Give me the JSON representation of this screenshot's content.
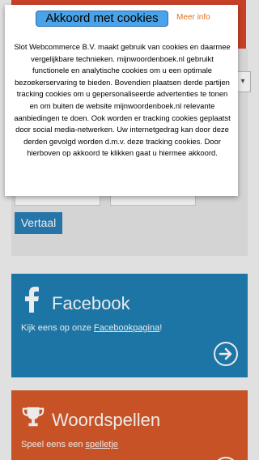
{
  "cookie_banner": {
    "accept_label": "Akkoord met cookies",
    "more_info_label": "Meer info",
    "body_text": "Slot Webcommerce B.V. maakt gebruik van cookies en daarmee vergelijkbare technieken. mijnwoordenboek.nl gebruikt functionele en analytische cookies om u een optimale bezoekerservaring te bieden. Bovendien plaatsen derde partijen tracking cookies om u gepersonaliseerde advertenties te tonen en om buiten de website mijnwoordenboek.nl relevante aanbiedingen te doen. Ook worden er tracking cookies geplaatst door social media-netwerken. Uw internetgedrag kan door deze derden gevolgd worden d.m.v. deze tracking cookies. Door hierboven op akkoord te klikken gaat u hiermee akkoord."
  },
  "translate_form": {
    "submit_label": "Vertaal"
  },
  "facebook_card": {
    "title": "Facebook",
    "text_prefix": "Kijk eens op onze ",
    "link_label": "Facebookpagina",
    "text_suffix": "!",
    "icon": "facebook-icon"
  },
  "games_card": {
    "title": "Woordspellen",
    "text_prefix": "Speel eens een ",
    "link_label": "spelletje",
    "icon": "trophy-icon"
  },
  "colors": {
    "facebook_blue": "#1f7fb3",
    "games_orange": "#d85a2a",
    "accent_red": "#d9472b",
    "button_blue": "#2a7fb8",
    "more_info_orange": "#e0731f"
  }
}
